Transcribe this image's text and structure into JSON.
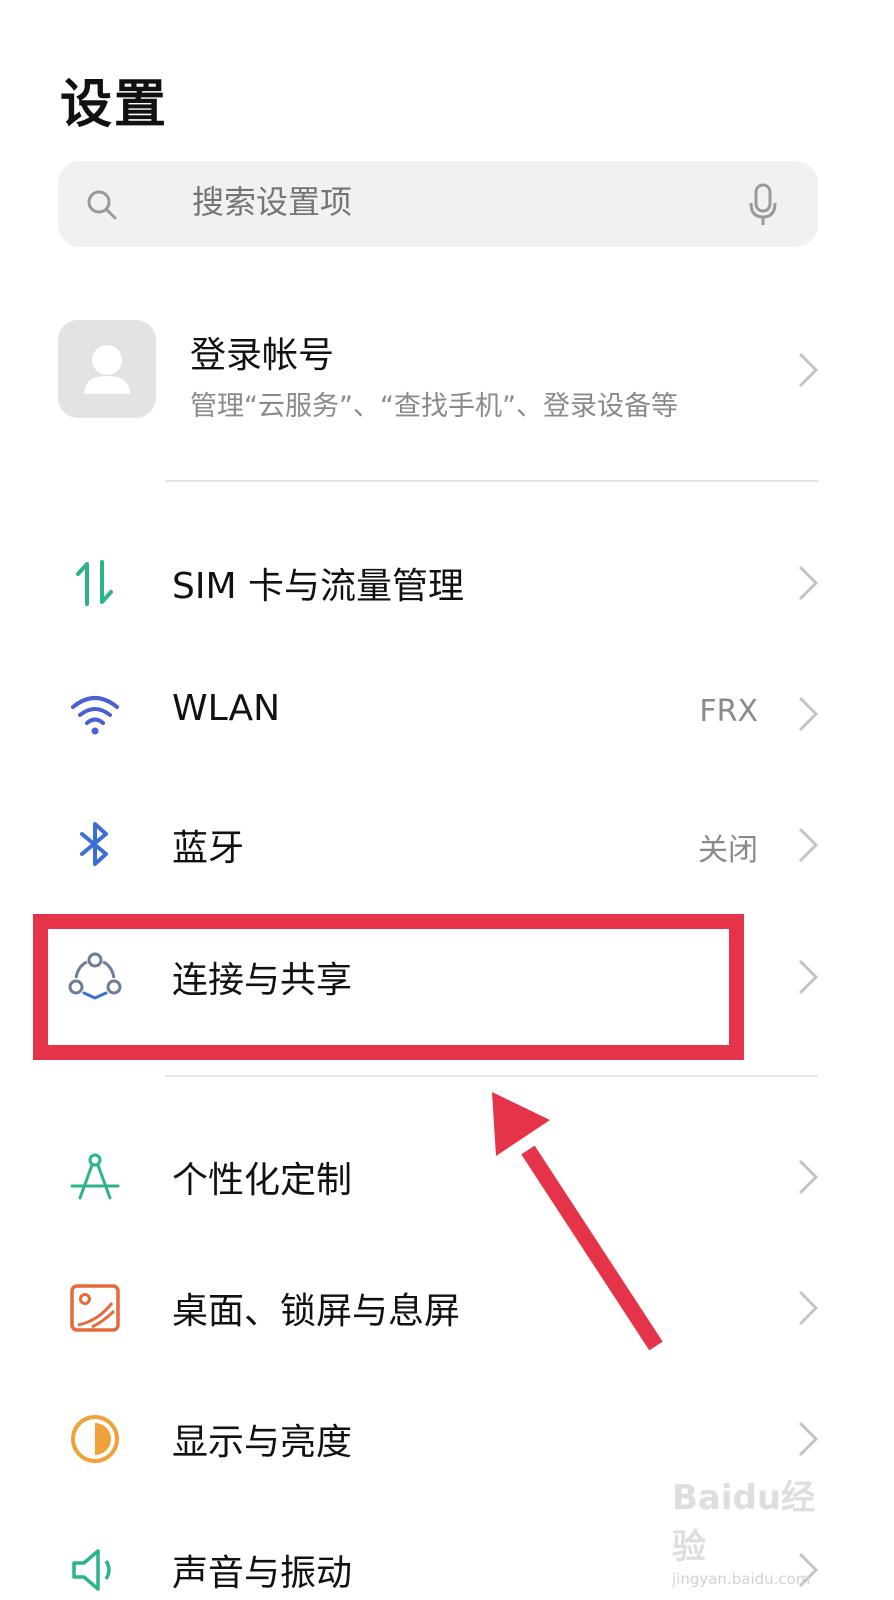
{
  "header": {
    "title": "设置"
  },
  "search": {
    "placeholder": "搜索设置项",
    "search_icon": "search-icon",
    "voice_icon": "microphone-icon"
  },
  "account": {
    "title": "登录帐号",
    "subtitle": "管理“云服务”、“查找手机”、登录设备等",
    "avatar_icon": "user-avatar-icon"
  },
  "settings": {
    "items": [
      {
        "label": "SIM 卡与流量管理",
        "value": "",
        "icon": "sim-data-icon",
        "icon_color": "#2bb38a"
      },
      {
        "label": "WLAN",
        "value": "FRX",
        "icon": "wifi-icon",
        "icon_color": "#4a5fd4"
      },
      {
        "label": "蓝牙",
        "value": "关闭",
        "icon": "bluetooth-icon",
        "icon_color": "#3b6fd6"
      },
      {
        "label": "连接与共享",
        "value": "",
        "icon": "connection-share-icon",
        "icon_color": "#6e7d95"
      },
      {
        "label": "个性化定制",
        "value": "",
        "icon": "compass-personalize-icon",
        "icon_color": "#2bb38a"
      },
      {
        "label": "桌面、锁屏与息屏",
        "value": "",
        "icon": "wallpaper-icon",
        "icon_color": "#e36a3b"
      },
      {
        "label": "显示与亮度",
        "value": "",
        "icon": "brightness-icon",
        "icon_color": "#f0a23a"
      },
      {
        "label": "声音与振动",
        "value": "",
        "icon": "sound-icon",
        "icon_color": "#2bb38a"
      }
    ]
  },
  "annotation": {
    "highlight_color": "#e5344a"
  },
  "watermark": {
    "brand": "Baidu经验",
    "url": "jingyan.baidu.com"
  }
}
